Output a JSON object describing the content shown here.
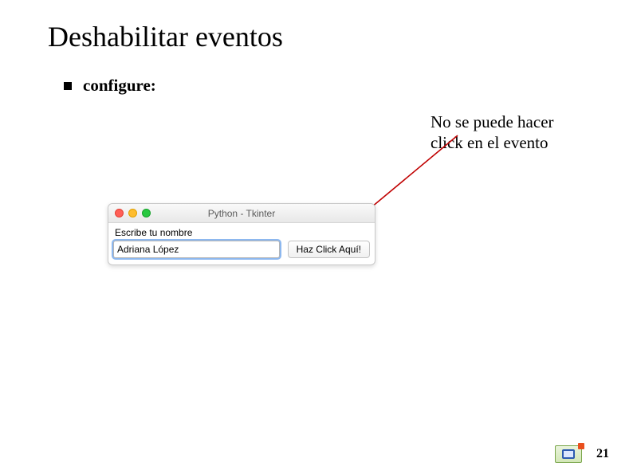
{
  "title": "Deshabilitar eventos",
  "bullet": "configure:",
  "annotation": "No se puede hacer click en el evento",
  "window": {
    "title": "Python - Tkinter",
    "label": "Escribe tu nombre",
    "input_value": "Adriana López",
    "button_label": "Haz Click Aquí!"
  },
  "page_number": "21"
}
